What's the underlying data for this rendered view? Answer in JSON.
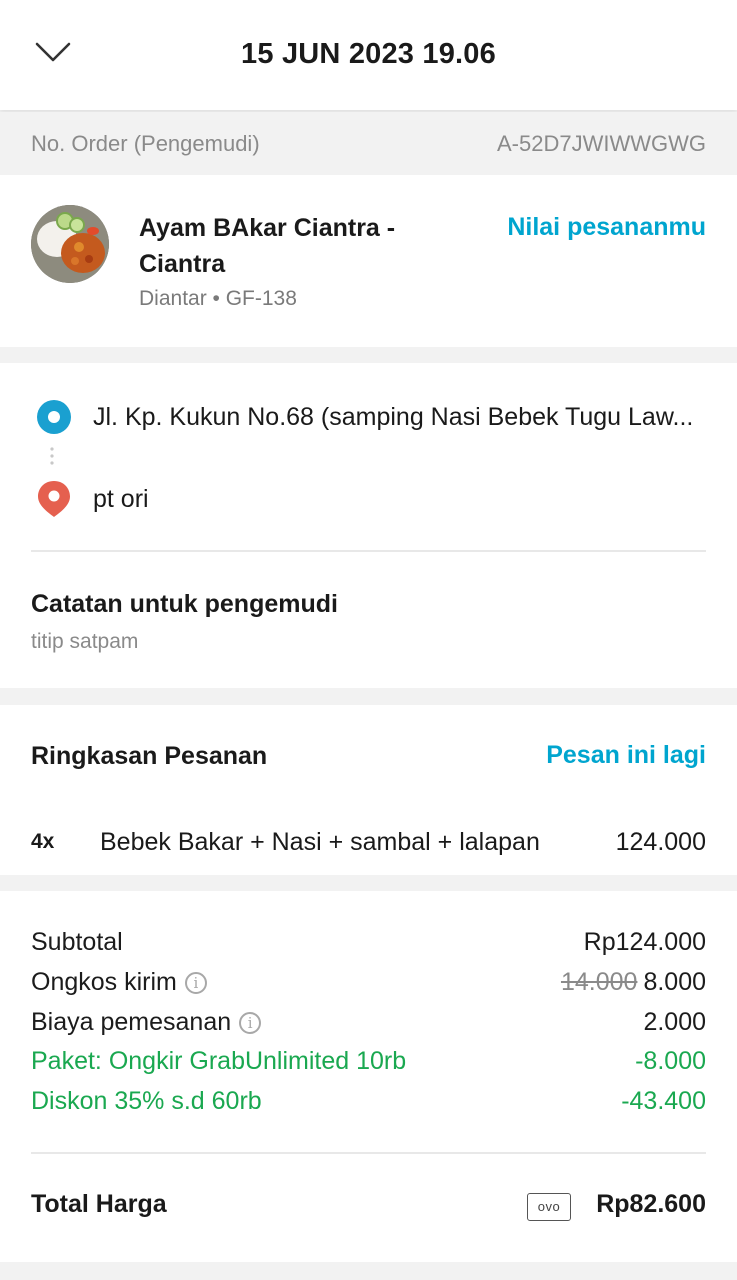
{
  "header": {
    "title": "15 JUN 2023 19.06",
    "back_icon": "chevron-down-icon"
  },
  "order": {
    "label": "No. Order (Pengemudi)",
    "number": "A-52D7JWIWWGWG"
  },
  "restaurant": {
    "name": "Ayam BAkar Ciantra - Ciantra",
    "subtitle": "Diantar • GF-138",
    "rate_link": "Nilai pesananmu"
  },
  "route": {
    "from": "Jl. Kp. Kukun No.68 (samping Nasi Bebek Tugu Law...",
    "to": "pt ori"
  },
  "note": {
    "title": "Catatan untuk pengemudi",
    "text": "titip satpam"
  },
  "summary": {
    "title": "Ringkasan Pesanan",
    "reorder_link": "Pesan ini lagi",
    "items": [
      {
        "qty": "4x",
        "name": "Bebek Bakar + Nasi + sambal + lalapan",
        "price": "124.000"
      }
    ]
  },
  "totals": {
    "subtotal_label": "Subtotal",
    "subtotal_value": "Rp124.000",
    "delivery_label": "Ongkos kirim",
    "delivery_old": "14.000",
    "delivery_value": "8.000",
    "service_label": "Biaya pemesanan",
    "service_value": "2.000",
    "promo1_label": "Paket: Ongkir GrabUnlimited 10rb",
    "promo1_value": "-8.000",
    "promo2_label": "Diskon 35% s.d 60rb",
    "promo2_value": "-43.400",
    "total_label": "Total Harga",
    "payment_badge": "ovo",
    "total_value": "Rp82.600"
  },
  "colors": {
    "accent": "#00a5cf",
    "discount": "#1aa850",
    "origin_pin": "#1aa0d0",
    "destination_pin": "#e5604f"
  }
}
